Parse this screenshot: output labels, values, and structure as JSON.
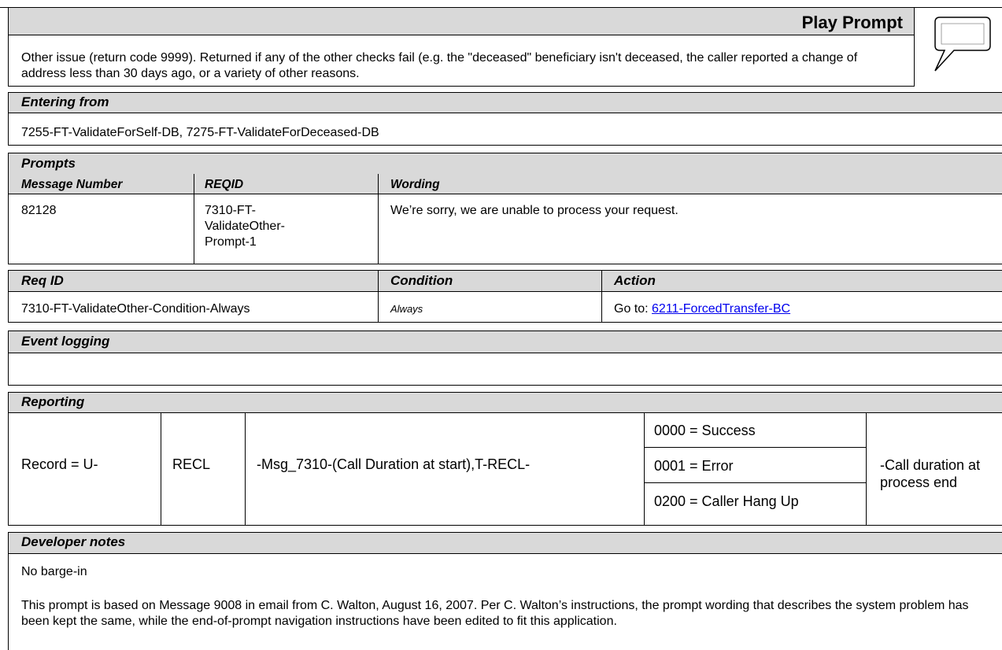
{
  "header": {
    "title": "Play Prompt",
    "description": "Other issue (return code 9999).  Returned if any of the other checks fail (e.g. the \"deceased\" beneficiary isn't deceased, the caller reported a change of address less than 30 days ago, or a variety of other reasons.",
    "icon": "speech-bubble-icon"
  },
  "entering_from": {
    "title": "Entering from",
    "value": "7255-FT-ValidateForSelf-DB, 7275-FT-ValidateForDeceased-DB"
  },
  "prompts": {
    "title": "Prompts",
    "columns": [
      "Message Number",
      "REQID",
      "Wording"
    ],
    "rows": [
      {
        "message_number": "82128",
        "reqid": "7310-FT-ValidateOther-Prompt-1",
        "wording": "We’re sorry, we are unable to process your request."
      }
    ]
  },
  "conditions": {
    "columns": [
      "Req ID",
      "Condition",
      "Action"
    ],
    "rows": [
      {
        "req_id": "7310-FT-ValidateOther-Condition-Always",
        "condition": "Always",
        "action_prefix": "Go to: ",
        "action_link": "6211-ForcedTransfer-BC"
      }
    ]
  },
  "event_logging": {
    "title": "Event logging"
  },
  "reporting": {
    "title": "Reporting",
    "record": "Record = U-",
    "recl": "RECL",
    "msg": "-Msg_7310-(Call Duration at start),T-RECL-",
    "codes": [
      "0000 = Success",
      "0001 = Error",
      "0200 = Caller Hang Up"
    ],
    "duration": "-Call duration at process end"
  },
  "developer_notes": {
    "title": "Developer notes",
    "note1": "No barge-in",
    "note2": "This prompt is based on Message 9008 in email from C. Walton, August 16, 2007.  Per C. Walton’s instructions, the prompt wording that describes the system problem has been kept the same, while the end-of-prompt navigation instructions have been edited to fit this application."
  }
}
